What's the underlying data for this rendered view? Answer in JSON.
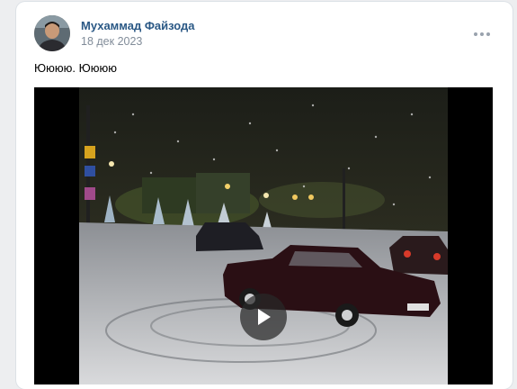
{
  "post": {
    "author": "Мухаммад Файзода",
    "date": "18 дек 2023",
    "text": "Юююю. Юююю"
  },
  "icons": {
    "more": "more-horizontal-icon",
    "play": "play-icon"
  },
  "colors": {
    "author_link": "#2a5885",
    "date": "#818c99",
    "background": "#edeef0"
  }
}
